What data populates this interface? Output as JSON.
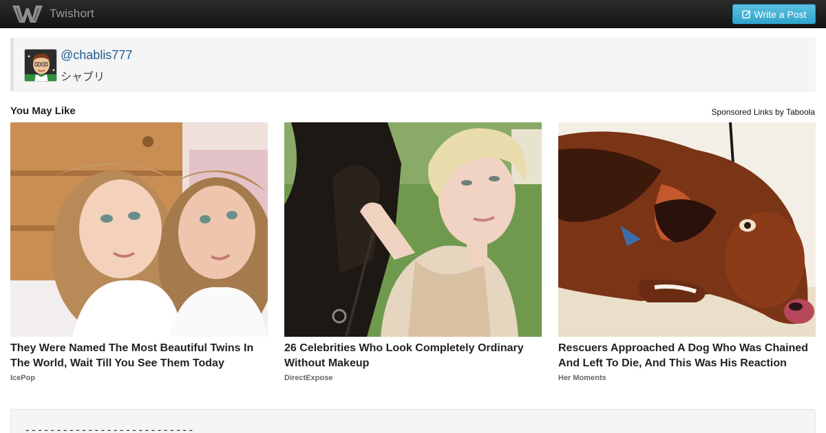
{
  "navbar": {
    "brand_name": "Twishort",
    "write_button_label": "Write a Post",
    "colors": {
      "background": "#1b1b1b",
      "button": "#41b3d9",
      "brand_text": "#9d9d9d"
    }
  },
  "profile": {
    "handle": "chablis777",
    "at_sign": "@",
    "display_name": "シャブリ",
    "avatar_icon": "bitmoji-avatar-icon"
  },
  "widget": {
    "title": "You May Like",
    "sponsored_label": "Sponsored Links by Taboola"
  },
  "cards": [
    {
      "title": "They Were Named The Most Beautiful Twins In The World, Wait Till You See Them Today",
      "source": "IcePop",
      "image": "twin-girls-photo"
    },
    {
      "title": "26 Celebrities Who Look Completely Ordinary Without Makeup",
      "source": "DirectExpose",
      "image": "blonde-woman-with-horse-photo"
    },
    {
      "title": "Rescuers Approached A Dog Who Was Chained And Left To Die, And This Was His Reaction",
      "source": "Her Moments",
      "image": "brown-dog-lying-photo"
    }
  ],
  "post": {
    "text": "---------------------------"
  }
}
